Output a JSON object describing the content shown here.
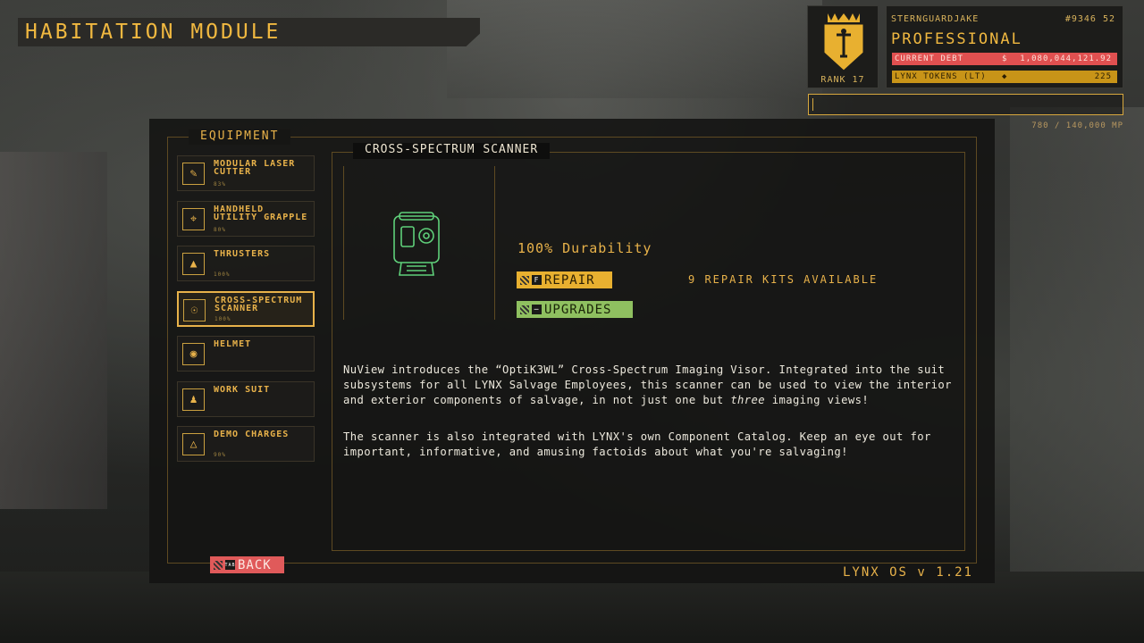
{
  "module_title": "HABITATION MODULE",
  "profile": {
    "rank_label": "RANK 17",
    "username": "STERNGUARDJAKE",
    "user_id": "#9346 52",
    "tier": "PROFESSIONAL",
    "debt_label": "CURRENT DEBT",
    "debt_currency": "$",
    "debt_value": "1,080,044,121.92",
    "tokens_label": "LYNX TOKENS (LT)",
    "tokens_value": "225",
    "mass_readout": "780 / 140,000 MP"
  },
  "equipment": {
    "header": "EQUIPMENT",
    "items": [
      {
        "name": "MODULAR LASER CUTTER",
        "pct": "83%",
        "icon": "laser-cutter-icon"
      },
      {
        "name": "HANDHELD UTILITY GRAPPLE",
        "pct": "80%",
        "icon": "grapple-icon"
      },
      {
        "name": "THRUSTERS",
        "pct": "100%",
        "icon": "thrusters-icon"
      },
      {
        "name": "CROSS-SPECTRUM SCANNER",
        "pct": "100%",
        "icon": "scanner-icon"
      },
      {
        "name": "HELMET",
        "pct": "",
        "icon": "helmet-icon"
      },
      {
        "name": "WORK SUIT",
        "pct": "",
        "icon": "work-suit-icon"
      },
      {
        "name": "DEMO CHARGES",
        "pct": "90%",
        "icon": "demo-charges-icon"
      }
    ],
    "selected_index": 3
  },
  "detail": {
    "title": "CROSS-SPECTRUM SCANNER",
    "durability": "100% Durability",
    "repair_label": "REPAIR",
    "repair_key": "F",
    "upgrades_label": "UPGRADES",
    "repair_kits": "9 REPAIR KITS AVAILABLE",
    "desc_1a": "NuView introduces the “OptiK3WL” Cross-Spectrum Imaging Visor. Integrated into the suit subsystems for all LYNX Salvage Employees, this scanner can be used to view the interior and exterior components of salvage, in not just one but ",
    "desc_1_em": "three",
    "desc_1b": " imaging views!",
    "desc_2": "The scanner is also integrated with LYNX's own Component Catalog. Keep an eye out for important, informative, and amusing factoids about what you're salvaging!"
  },
  "back_label": "BACK",
  "back_key": "TAB",
  "os_version": "LYNX OS v 1.21",
  "colors": {
    "accent": "#e8b24a",
    "debt": "#e05050",
    "tokens": "#c89418",
    "upgrade": "#8fc060",
    "back": "#e05a5a"
  }
}
